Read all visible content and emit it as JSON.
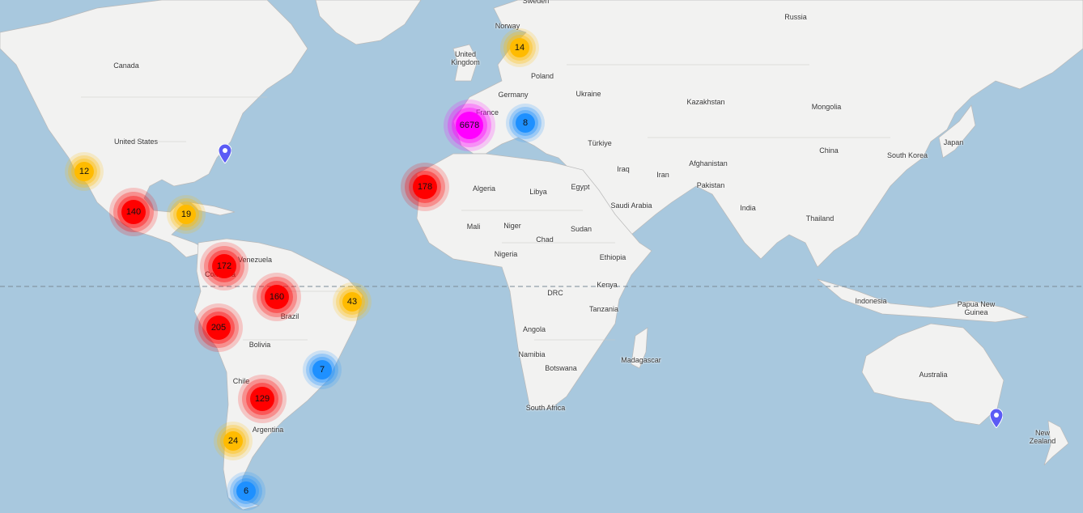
{
  "map": {
    "colors": {
      "water": "#a8c8de",
      "land": "#f2f2f1",
      "border": "#b9b9b9",
      "equator": "#7a8a96"
    },
    "countries": [
      {
        "id": "canada",
        "label": "Canada"
      },
      {
        "id": "usa",
        "label": "United States"
      },
      {
        "id": "venezuela",
        "label": "Venezuela"
      },
      {
        "id": "colombia",
        "label": "Colombia"
      },
      {
        "id": "brazil",
        "label": "Brazil"
      },
      {
        "id": "bolivia",
        "label": "Bolivia"
      },
      {
        "id": "chile",
        "label": "Chile"
      },
      {
        "id": "argentina",
        "label": "Argentina"
      },
      {
        "id": "norway",
        "label": "Norway"
      },
      {
        "id": "sweden",
        "label": "Sweden"
      },
      {
        "id": "uk",
        "label": "United Kingdom"
      },
      {
        "id": "poland",
        "label": "Poland"
      },
      {
        "id": "germany",
        "label": "Germany"
      },
      {
        "id": "france",
        "label": "France"
      },
      {
        "id": "ukraine",
        "label": "Ukraine"
      },
      {
        "id": "russia",
        "label": "Russia"
      },
      {
        "id": "kazakhstan",
        "label": "Kazakhstan"
      },
      {
        "id": "mongolia",
        "label": "Mongolia"
      },
      {
        "id": "turkiye",
        "label": "Türkiye"
      },
      {
        "id": "china",
        "label": "China"
      },
      {
        "id": "south-korea",
        "label": "South Korea"
      },
      {
        "id": "japan",
        "label": "Japan"
      },
      {
        "id": "iraq",
        "label": "Iraq"
      },
      {
        "id": "iran",
        "label": "Iran"
      },
      {
        "id": "afghanistan",
        "label": "Afghanistan"
      },
      {
        "id": "pakistan",
        "label": "Pakistan"
      },
      {
        "id": "india",
        "label": "India"
      },
      {
        "id": "thailand",
        "label": "Thailand"
      },
      {
        "id": "algeria",
        "label": "Algeria"
      },
      {
        "id": "libya",
        "label": "Libya"
      },
      {
        "id": "egypt",
        "label": "Egypt"
      },
      {
        "id": "saudi-arabia",
        "label": "Saudi Arabia"
      },
      {
        "id": "mali",
        "label": "Mali"
      },
      {
        "id": "niger",
        "label": "Niger"
      },
      {
        "id": "chad",
        "label": "Chad"
      },
      {
        "id": "sudan",
        "label": "Sudan"
      },
      {
        "id": "nigeria",
        "label": "Nigeria"
      },
      {
        "id": "ethiopia",
        "label": "Ethiopia"
      },
      {
        "id": "kenya",
        "label": "Kenya"
      },
      {
        "id": "drc",
        "label": "DRC"
      },
      {
        "id": "tanzania",
        "label": "Tanzania"
      },
      {
        "id": "angola",
        "label": "Angola"
      },
      {
        "id": "namibia",
        "label": "Namibia"
      },
      {
        "id": "botswana",
        "label": "Botswana"
      },
      {
        "id": "madagascar",
        "label": "Madagascar"
      },
      {
        "id": "south-africa",
        "label": "South Africa"
      },
      {
        "id": "indonesia",
        "label": "Indonesia"
      },
      {
        "id": "papua-new-guinea",
        "label": "Papua New Guinea"
      },
      {
        "id": "australia",
        "label": "Australia"
      },
      {
        "id": "new-zealand",
        "label": "New Zealand"
      }
    ],
    "clusters": [
      {
        "id": "europe",
        "count": "6678",
        "color": "#ff00ff",
        "level": "high"
      },
      {
        "id": "peru",
        "count": "205",
        "color": "#ff0000",
        "level": "medium"
      },
      {
        "id": "west-sahara",
        "count": "178",
        "color": "#ff0000",
        "level": "medium"
      },
      {
        "id": "colombia",
        "count": "172",
        "color": "#ff0000",
        "level": "medium"
      },
      {
        "id": "brazil-north",
        "count": "160",
        "color": "#ff0000",
        "level": "medium"
      },
      {
        "id": "mexico",
        "count": "140",
        "color": "#ff0000",
        "level": "medium"
      },
      {
        "id": "argentina",
        "count": "129",
        "color": "#ff0000",
        "level": "medium"
      },
      {
        "id": "brazil-east",
        "count": "43",
        "color": "#ffbb00",
        "level": "low"
      },
      {
        "id": "patagonia",
        "count": "24",
        "color": "#ffbb00",
        "level": "low"
      },
      {
        "id": "yucatan",
        "count": "19",
        "color": "#ffbb00",
        "level": "low"
      },
      {
        "id": "scandinavia",
        "count": "14",
        "color": "#ffbb00",
        "level": "low"
      },
      {
        "id": "baja",
        "count": "12",
        "color": "#ffbb00",
        "level": "low"
      },
      {
        "id": "italy",
        "count": "8",
        "color": "#1e90ff",
        "level": "small"
      },
      {
        "id": "brazil-south",
        "count": "7",
        "color": "#1e90ff",
        "level": "small"
      },
      {
        "id": "tierra-del-fuego",
        "count": "6",
        "color": "#1e90ff",
        "level": "small"
      }
    ],
    "markers": [
      {
        "id": "usa-east",
        "color": "#5b5bf5"
      },
      {
        "id": "australia-east",
        "color": "#5b5bf5"
      }
    ]
  }
}
